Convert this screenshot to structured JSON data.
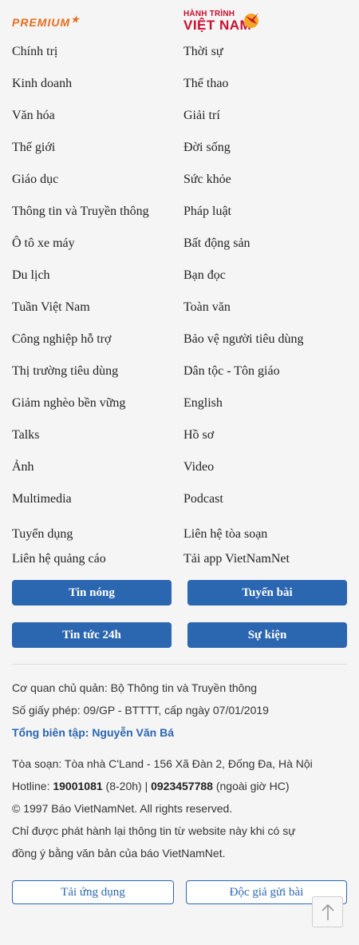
{
  "logos": {
    "premium": "PREMIUM",
    "premium_star": "★",
    "htvn_top": "HÀNH TRÌNH",
    "htvn_bottom": "VIỆT NAM"
  },
  "nav": [
    "Chính trị",
    "Thời sự",
    "Kinh doanh",
    "Thể thao",
    "Văn hóa",
    "Giải trí",
    "Thế giới",
    "Đời sống",
    "Giáo dục",
    "Sức khỏe",
    "Thông tin và Truyền thông",
    "Pháp luật",
    "Ô tô xe máy",
    "Bất động sản",
    "Du lịch",
    "Bạn đọc",
    "Tuần Việt Nam",
    "Toàn văn",
    "Công nghiệp hỗ trợ",
    "Bảo vệ người tiêu dùng",
    "Thị trường tiêu dùng",
    "Dân tộc - Tôn giáo",
    "Giảm nghèo bền vững",
    "English",
    "Talks",
    "Hồ sơ",
    "Ảnh",
    "Video",
    "Multimedia",
    "Podcast",
    "Tuyển dụng",
    "Liên hệ tòa soạn",
    "Liên hệ quảng cáo",
    "Tải app VietNamNet"
  ],
  "buttons": [
    "Tin nóng",
    "Tuyến bài",
    "Tin tức 24h",
    "Sự kiện"
  ],
  "info": {
    "owner": "Cơ quan chủ quản: Bộ Thông tin và Truyền thông",
    "license": "Số giấy phép: 09/GP - BTTTT, cấp ngày 07/01/2019",
    "editor": "Tổng biên tập: Nguyễn Văn Bá",
    "address": "Tòa soạn: Tòa nhà C'Land - 156 Xã Đàn 2, Đống Đa, Hà Nội",
    "hotline_label": "Hotline: ",
    "hotline1": "19001081",
    "hotline1_note": " (8-20h) | ",
    "hotline2": "0923457788",
    "hotline2_note": " (ngoài giờ HC)",
    "copyright": "© 1997 Báo VietNamNet. All rights reserved.",
    "notice1": "Chỉ được phát hành lại thông tin từ website này khi có sự",
    "notice2": "đồng ý bằng văn bản của báo VietNamNet."
  },
  "footer_buttons": {
    "download_app": "Tải ứng dụng",
    "submit_article": "Độc giả gửi bài"
  },
  "colors": {
    "accent": "#2b66b1",
    "premium": "#e86b1c",
    "htvn": "#c8102e"
  }
}
